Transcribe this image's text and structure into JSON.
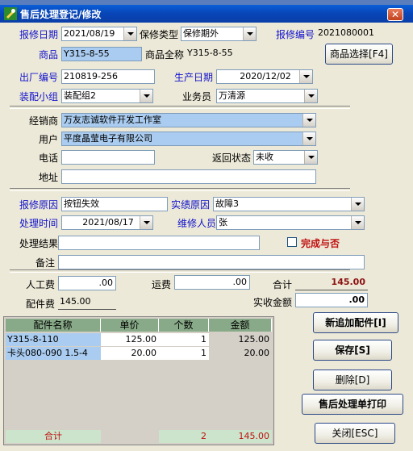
{
  "window": {
    "title": "售后处理登记/修改",
    "close_label": "✕"
  },
  "form": {
    "repair_date_label": "报修日期",
    "repair_date": "2021/08/19",
    "repair_type_label": "保修类型",
    "repair_type": "保修期外",
    "repair_no_label": "报修编号",
    "repair_no": "2021080001",
    "product_label": "商品",
    "product": "Y315-8-55",
    "product_fullname_label": "商品全称",
    "product_fullname": "Y315-8-55",
    "product_select_button": "商品选择[F4]",
    "serial_label": "出厂编号",
    "serial": "210819-256",
    "production_date_label": "生产日期",
    "production_date": "2020/12/02",
    "assembly_group_label": "装配小组",
    "assembly_group": "装配组2",
    "salesman_label": "业务员",
    "salesman": "万清源",
    "dealer_label": "经销商",
    "dealer": "万友志诚软件开发工作室",
    "user_label": "用户",
    "user": "平度晶莹电子有限公司",
    "phone_label": "电话",
    "phone": "",
    "return_status_label": "返回状态",
    "return_status": "未收",
    "address_label": "地址",
    "address": "",
    "repair_reason_label": "报修原因",
    "repair_reason": "按钮失效",
    "actual_reason_label": "实绩原因",
    "actual_reason": "故障3",
    "process_time_label": "处理时间",
    "process_time": "2021/08/17",
    "repairer_label": "维修人员",
    "repairer": "张",
    "process_result_label": "处理结果",
    "process_result": "",
    "complete_label": "完成与否",
    "remark_label": "备注",
    "remark": "",
    "labor_fee_label": "人工费",
    "labor_fee": ".00",
    "freight_label": "运费",
    "freight": ".00",
    "total_label": "合计",
    "total": "145.00",
    "parts_fee_label": "配件费",
    "parts_fee": "145.00",
    "actual_amount_label": "实收金额",
    "actual_amount": ".00"
  },
  "parts_table": {
    "headers": [
      "配件名称",
      "单价",
      "个数",
      "金额"
    ],
    "rows": [
      [
        "Y315-8-110",
        "125.00",
        "1",
        "125.00"
      ],
      [
        "卡头080-090 1.5-4",
        "20.00",
        "1",
        "20.00"
      ]
    ],
    "footer": [
      "合计",
      "",
      "2",
      "145.00"
    ]
  },
  "buttons": {
    "add_part": "新追加配件[I]",
    "save": "保存[S]",
    "delete": "删除[D]",
    "print": "售后处理单打印",
    "close": "关闭[ESC]"
  },
  "colors": {
    "title_bar": "#0845b6",
    "label_blue": "#1111cc",
    "label_red": "#c01010",
    "selected_field": "#aaccf0",
    "grid_header": "#88aa88"
  }
}
